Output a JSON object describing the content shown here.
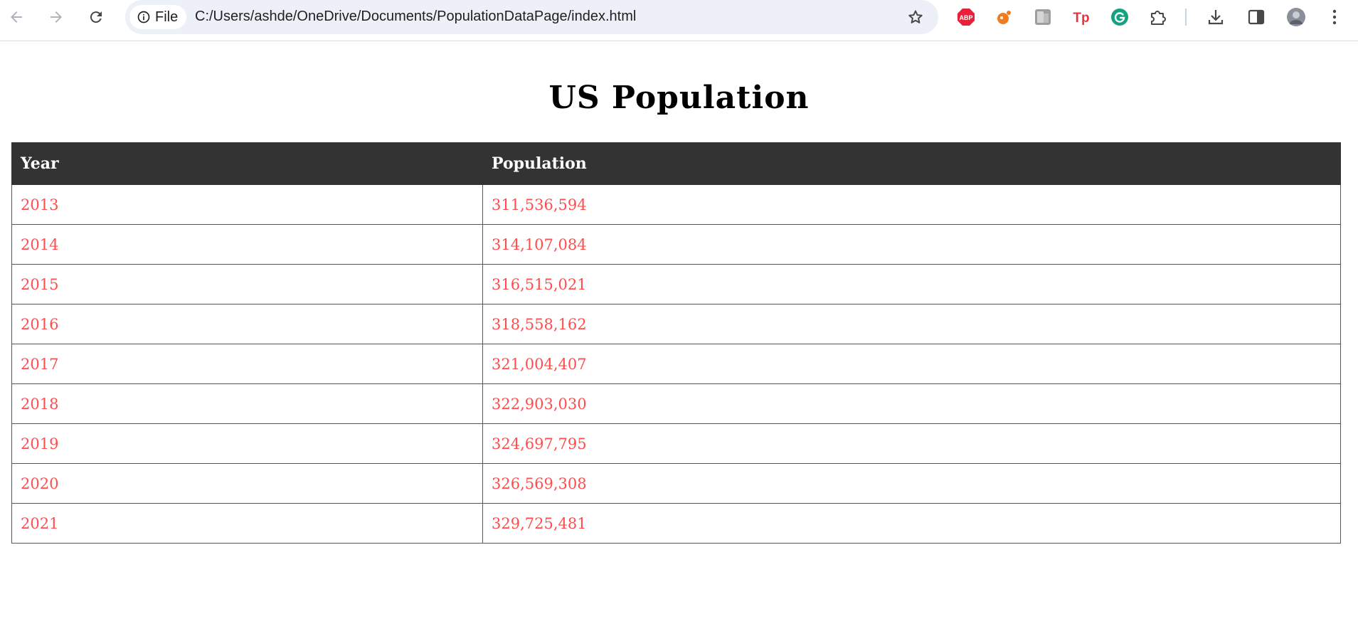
{
  "browser": {
    "site_chip_label": "File",
    "url": "C:/Users/ashde/OneDrive/Documents/PopulationDataPage/index.html"
  },
  "page": {
    "title": "US Population"
  },
  "table": {
    "headers": [
      "Year",
      "Population"
    ],
    "rows": [
      [
        "2013",
        "311,536,594"
      ],
      [
        "2014",
        "314,107,084"
      ],
      [
        "2015",
        "316,515,021"
      ],
      [
        "2016",
        "318,558,162"
      ],
      [
        "2017",
        "321,004,407"
      ],
      [
        "2018",
        "322,903,030"
      ],
      [
        "2019",
        "324,697,795"
      ],
      [
        "2020",
        "326,569,308"
      ],
      [
        "2021",
        "329,725,481"
      ]
    ]
  },
  "colors": {
    "header_bg": "#333333",
    "cell_text": "#ff4d4d"
  }
}
